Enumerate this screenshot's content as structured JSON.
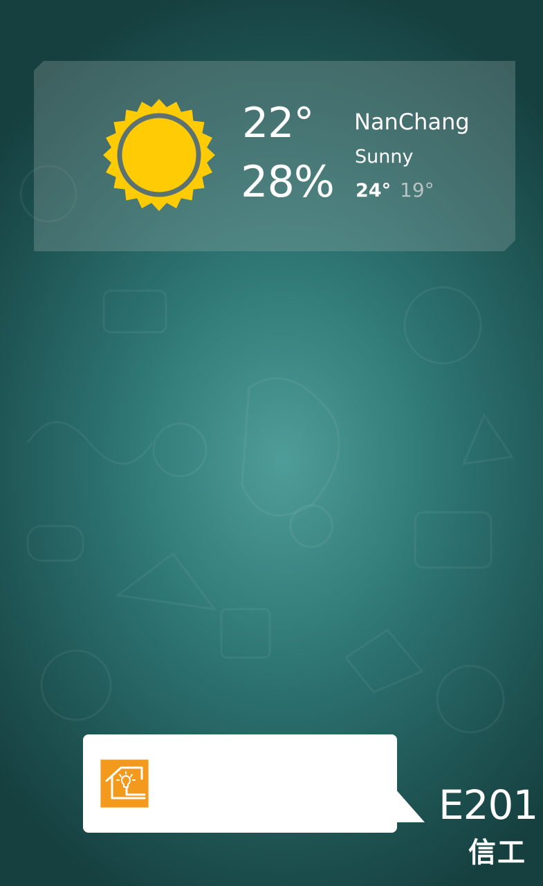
{
  "weather": {
    "icon": "sun-icon",
    "current_temp": "22°",
    "humidity": "28%",
    "city": "NanChang",
    "condition": "Sunny",
    "high": "24°",
    "low": "19°"
  },
  "message": {
    "app_icon": "smart-home-icon",
    "text": ""
  },
  "room": {
    "code": "E201",
    "building": "信工"
  },
  "colors": {
    "sun": "#ffcb05",
    "sun_ring": "#5c7270",
    "app_icon_bg": "#f39a1e",
    "background": "#2f7876"
  }
}
